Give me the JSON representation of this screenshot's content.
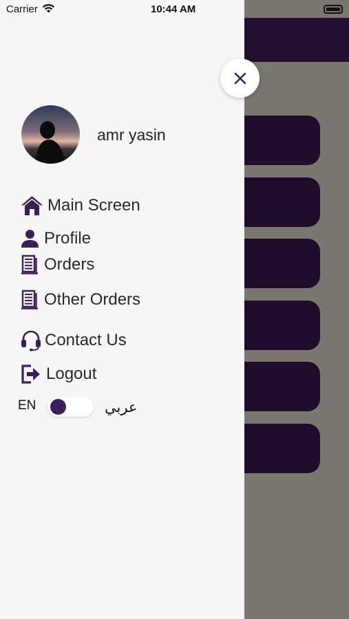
{
  "status_bar": {
    "carrier": "Carrier",
    "time": "10:44 AM"
  },
  "profile": {
    "name": "amr yasin"
  },
  "menu": [
    {
      "label": "Main Screen",
      "icon": "home-icon"
    },
    {
      "label": "Profile",
      "icon": "person-icon"
    },
    {
      "label": "Orders",
      "icon": "receipt-icon"
    },
    {
      "label": "Other Orders",
      "icon": "receipt-icon"
    },
    {
      "label": "Contact Us",
      "icon": "headset-icon"
    },
    {
      "label": "Logout",
      "icon": "logout-icon"
    }
  ],
  "language": {
    "en_label": "EN",
    "ar_label": "عربي",
    "toggle_on": false
  },
  "colors": {
    "accent": "#3b1f5a",
    "drawer_bg": "#f6f6f6",
    "overlay": "#7a7670",
    "card": "#1f0d2b"
  }
}
